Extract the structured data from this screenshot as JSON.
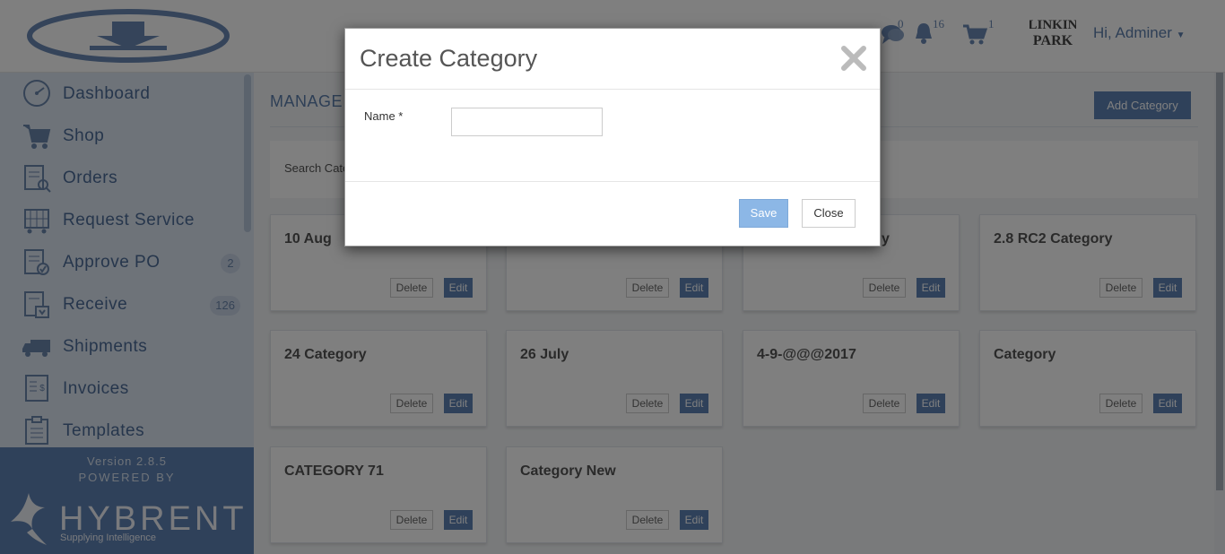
{
  "header": {
    "chat_count": "0",
    "notification_count": "16",
    "cart_count": "1",
    "user_greeting": "Hi, Adminer",
    "avatar_text": "LINKIN PARK"
  },
  "sidebar": {
    "items": [
      {
        "label": "Dashboard",
        "icon": "dashboard-icon"
      },
      {
        "label": "Shop",
        "icon": "cart-icon"
      },
      {
        "label": "Orders",
        "icon": "orders-icon"
      },
      {
        "label": "Request Service",
        "icon": "request-service-icon"
      },
      {
        "label": "Approve PO",
        "icon": "approve-po-icon",
        "badge": "2"
      },
      {
        "label": "Receive",
        "icon": "receive-icon",
        "badge": "126"
      },
      {
        "label": "Shipments",
        "icon": "truck-icon"
      },
      {
        "label": "Invoices",
        "icon": "invoice-icon"
      },
      {
        "label": "Templates",
        "icon": "templates-icon"
      }
    ],
    "version": "Version 2.8.5",
    "powered_by": "POWERED BY",
    "brand": "HYBRENT",
    "tagline": "Supplying Intelligence"
  },
  "main": {
    "title": "MANAGE CATEGORY",
    "add_button": "Add Category",
    "search_label": "Search Category",
    "cards": [
      {
        "title": "10 Aug"
      },
      {
        "title": ""
      },
      {
        "title": "y"
      },
      {
        "title": "2.8 RC2 Category"
      },
      {
        "title": "24 Category"
      },
      {
        "title": "26 July"
      },
      {
        "title": "4-9-@@@2017"
      },
      {
        "title": "Category"
      },
      {
        "title": "CATEGORY 71"
      },
      {
        "title": "Category New"
      }
    ],
    "delete_label": "Delete",
    "edit_label": "Edit"
  },
  "modal": {
    "title": "Create Category",
    "name_label": "Name *",
    "name_value": "",
    "save_label": "Save",
    "close_label": "Close"
  },
  "colors": {
    "brand_blue": "#5f82b5",
    "save_blue": "#8cb7e6"
  }
}
